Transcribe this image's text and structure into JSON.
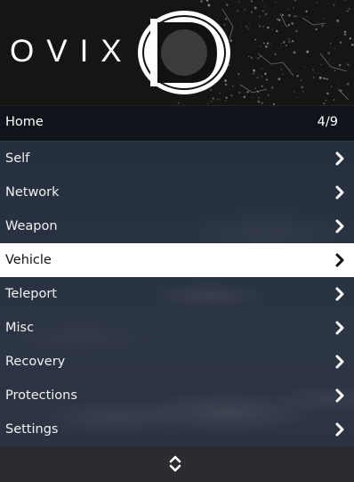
{
  "brand": {
    "text": "OVIX"
  },
  "submenu": {
    "title": "Home",
    "counter": "4/9"
  },
  "items": [
    {
      "label": "Self",
      "selected": false
    },
    {
      "label": "Network",
      "selected": false
    },
    {
      "label": "Weapon",
      "selected": false
    },
    {
      "label": "Vehicle",
      "selected": true
    },
    {
      "label": "Teleport",
      "selected": false
    },
    {
      "label": "Misc",
      "selected": false
    },
    {
      "label": "Recovery",
      "selected": false
    },
    {
      "label": "Protections",
      "selected": false
    },
    {
      "label": "Settings",
      "selected": false
    }
  ],
  "icons": {
    "item_arrow": "chevron-right-icon",
    "footer": "up-down-arrows-icon",
    "logo": "ovix-logo-mark"
  },
  "colors": {
    "header_bg": "#161514",
    "subheader_bg": "#0c0f14",
    "selected_bg": "#ffffff",
    "selected_text": "#111111",
    "item_text": "#f2f2f2",
    "footer_bg": "#2b2c2f"
  }
}
